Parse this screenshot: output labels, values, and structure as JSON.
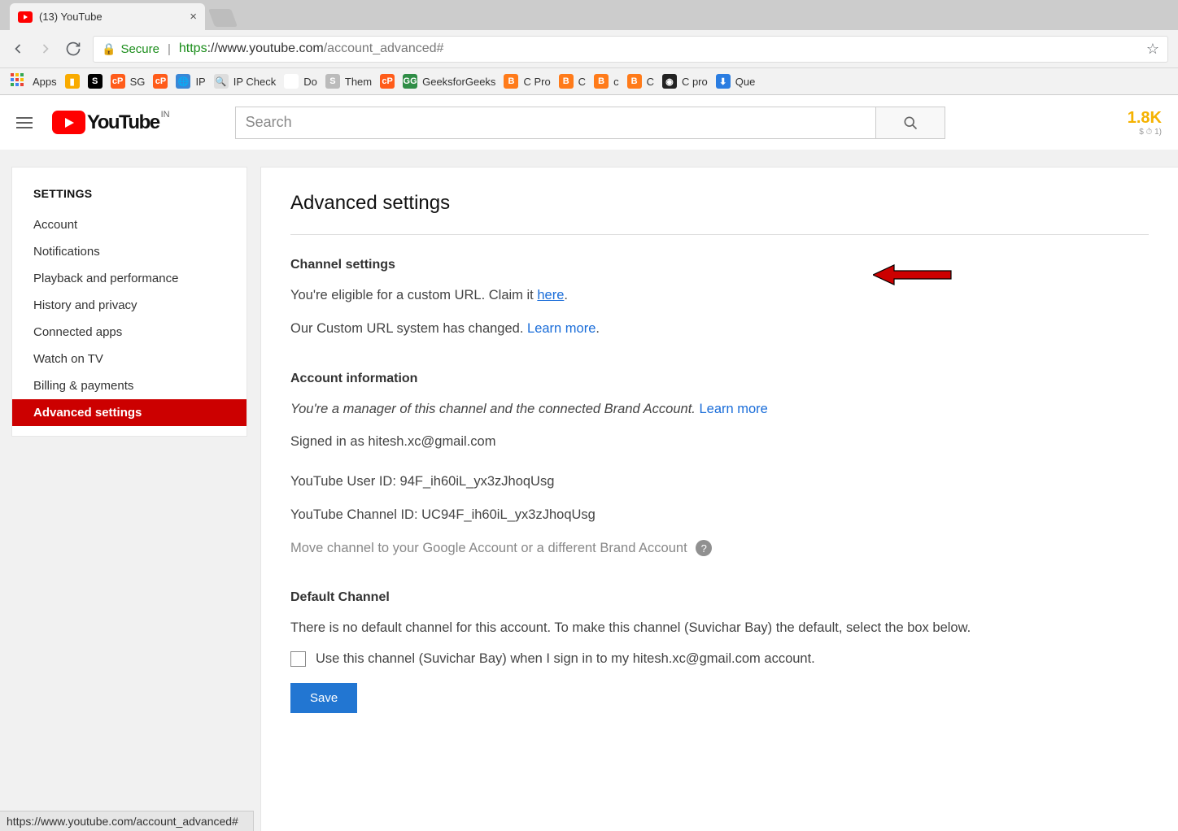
{
  "browser": {
    "tab_title": "(13) YouTube",
    "url_scheme": "https",
    "secure_label": "Secure",
    "url_host": "://www.youtube.com",
    "url_path": "/account_advanced#",
    "bookmarks": [
      {
        "label": "Apps",
        "color": "#fff",
        "glyph": "⠿",
        "glyphColor": "#888"
      },
      {
        "label": "",
        "color": "#f9ab00",
        "glyph": "▮"
      },
      {
        "label": "",
        "color": "#000",
        "glyph": "S"
      },
      {
        "label": "SG",
        "color": "#ff5c1a",
        "glyph": "cP"
      },
      {
        "label": "",
        "color": "#ff5c1a",
        "glyph": "cP"
      },
      {
        "label": "IP",
        "color": "#3a87d6",
        "glyph": "🌐"
      },
      {
        "label": "IP Check",
        "color": "#ddd",
        "glyph": "🔍"
      },
      {
        "label": "Do",
        "color": "#fff",
        "glyph": "G"
      },
      {
        "label": "Them",
        "color": "#bbb",
        "glyph": "S"
      },
      {
        "label": "",
        "color": "#ff5c1a",
        "glyph": "cP"
      },
      {
        "label": "GeeksforGeeks",
        "color": "#2f8d46",
        "glyph": "GG"
      },
      {
        "label": "C Pro",
        "color": "#ff7b1a",
        "glyph": "B"
      },
      {
        "label": "C",
        "color": "#ff7b1a",
        "glyph": "B"
      },
      {
        "label": "c",
        "color": "#ff7b1a",
        "glyph": "B"
      },
      {
        "label": "C",
        "color": "#ff7b1a",
        "glyph": "B"
      },
      {
        "label": "C pro",
        "color": "#222",
        "glyph": "◉"
      },
      {
        "label": "Que",
        "color": "#2b7de1",
        "glyph": "⬇"
      }
    ]
  },
  "header": {
    "logo_text": "YouTube",
    "region": "IN",
    "search_placeholder": "Search",
    "right_value": "1.8K",
    "right_sub": "$ ⏱ 1)"
  },
  "sidebar": {
    "heading": "SETTINGS",
    "items": [
      {
        "label": "Account"
      },
      {
        "label": "Notifications"
      },
      {
        "label": "Playback and performance"
      },
      {
        "label": "History and privacy"
      },
      {
        "label": "Connected apps"
      },
      {
        "label": "Watch on TV"
      },
      {
        "label": "Billing & payments"
      },
      {
        "label": "Advanced settings",
        "active": true
      }
    ]
  },
  "main": {
    "title": "Advanced settings",
    "channel_settings": {
      "heading": "Channel settings",
      "eligible_prefix": "You're eligible for a custom URL. Claim it ",
      "eligible_link": "here",
      "eligible_suffix": ".",
      "changed_prefix": "Our Custom URL system has changed. ",
      "changed_link": "Learn more",
      "changed_suffix": "."
    },
    "account_info": {
      "heading": "Account information",
      "manager_prefix": "You're a manager of this channel and the connected Brand Account. ",
      "manager_link": "Learn more",
      "signed_in": "Signed in as hitesh.xc@gmail.com",
      "user_id": "YouTube User ID: 94F_ih60iL_yx3zJhoqUsg",
      "channel_id": "YouTube Channel ID: UC94F_ih60iL_yx3zJhoqUsg",
      "move_channel": "Move channel to your Google Account or a different Brand Account"
    },
    "default_channel": {
      "heading": "Default Channel",
      "desc": "There is no default channel for this account. To make this channel (Suvichar Bay) the default, select the box below.",
      "checkbox_label": "Use this channel (Suvichar Bay) when I sign in to my hitesh.xc@gmail.com account.",
      "save": "Save"
    }
  },
  "status_bar": "https://www.youtube.com/account_advanced#"
}
